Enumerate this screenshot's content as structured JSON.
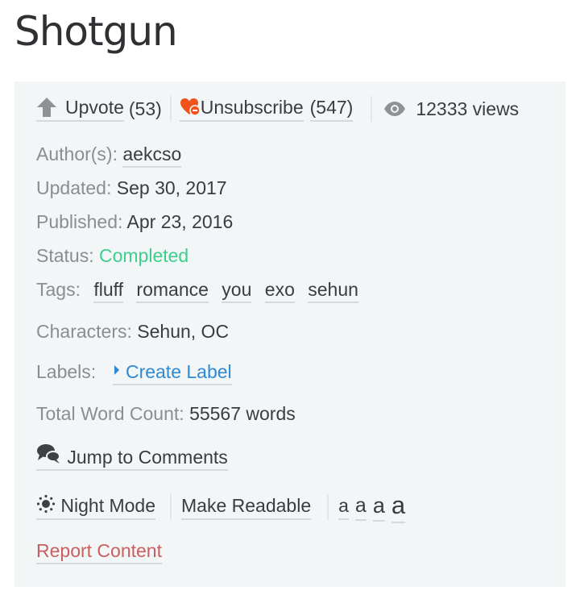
{
  "title": "Shotgun",
  "actions": {
    "upvote_label": "Upvote",
    "upvote_count": "(53)",
    "unsubscribe_label": "Unsubscribe",
    "unsubscribe_count": "(547)",
    "views": "12333 views"
  },
  "meta": {
    "author_label": "Author(s):",
    "author": "aekcso",
    "updated_label": "Updated:",
    "updated": "Sep 30, 2017",
    "published_label": "Published:",
    "published": "Apr 23, 2016",
    "status_label": "Status:",
    "status": "Completed",
    "tags_label": "Tags:",
    "tags": [
      "fluff",
      "romance",
      "you",
      "exo",
      "sehun"
    ],
    "characters_label": "Characters:",
    "characters": "Sehun, OC",
    "labels_label": "Labels:",
    "create_label": "Create Label",
    "word_count_label": "Total Word Count:",
    "word_count": "55567 words"
  },
  "links": {
    "jump_comments": "Jump to Comments",
    "night_mode": "Night Mode",
    "make_readable": "Make Readable",
    "font_sizes": [
      "a",
      "a",
      "a",
      "a"
    ],
    "report": "Report Content"
  },
  "colors": {
    "status": "#3ecf8e",
    "link": "#2d8ad4",
    "report": "#c95f5f",
    "heart": "#f0531c"
  }
}
